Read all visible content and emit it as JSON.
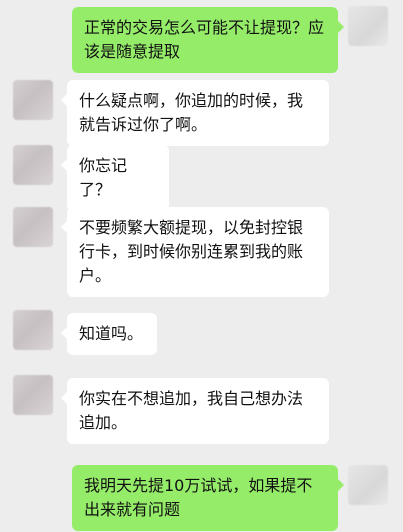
{
  "messages": [
    {
      "side": "right",
      "text": "正常的交易怎么可能不让提现？应该是随意提取"
    },
    {
      "side": "left",
      "text": "什么疑点啊，你追加的时候，我就告诉过你了啊。"
    },
    {
      "side": "left",
      "text": "你忘记了？"
    },
    {
      "side": "left",
      "text": "不要频繁大额提现，以免封控银行卡，到时候你别连累到我的账户。"
    },
    {
      "side": "left",
      "text": "知道吗。"
    },
    {
      "side": "left",
      "text": "你实在不想追加，我自己想办法追加。"
    },
    {
      "side": "right",
      "text": "我明天先提10万试试，如果提不出来就有问题"
    }
  ],
  "colors": {
    "background": "#ededed",
    "bubble_left": "#ffffff",
    "bubble_right": "#95ec69"
  }
}
